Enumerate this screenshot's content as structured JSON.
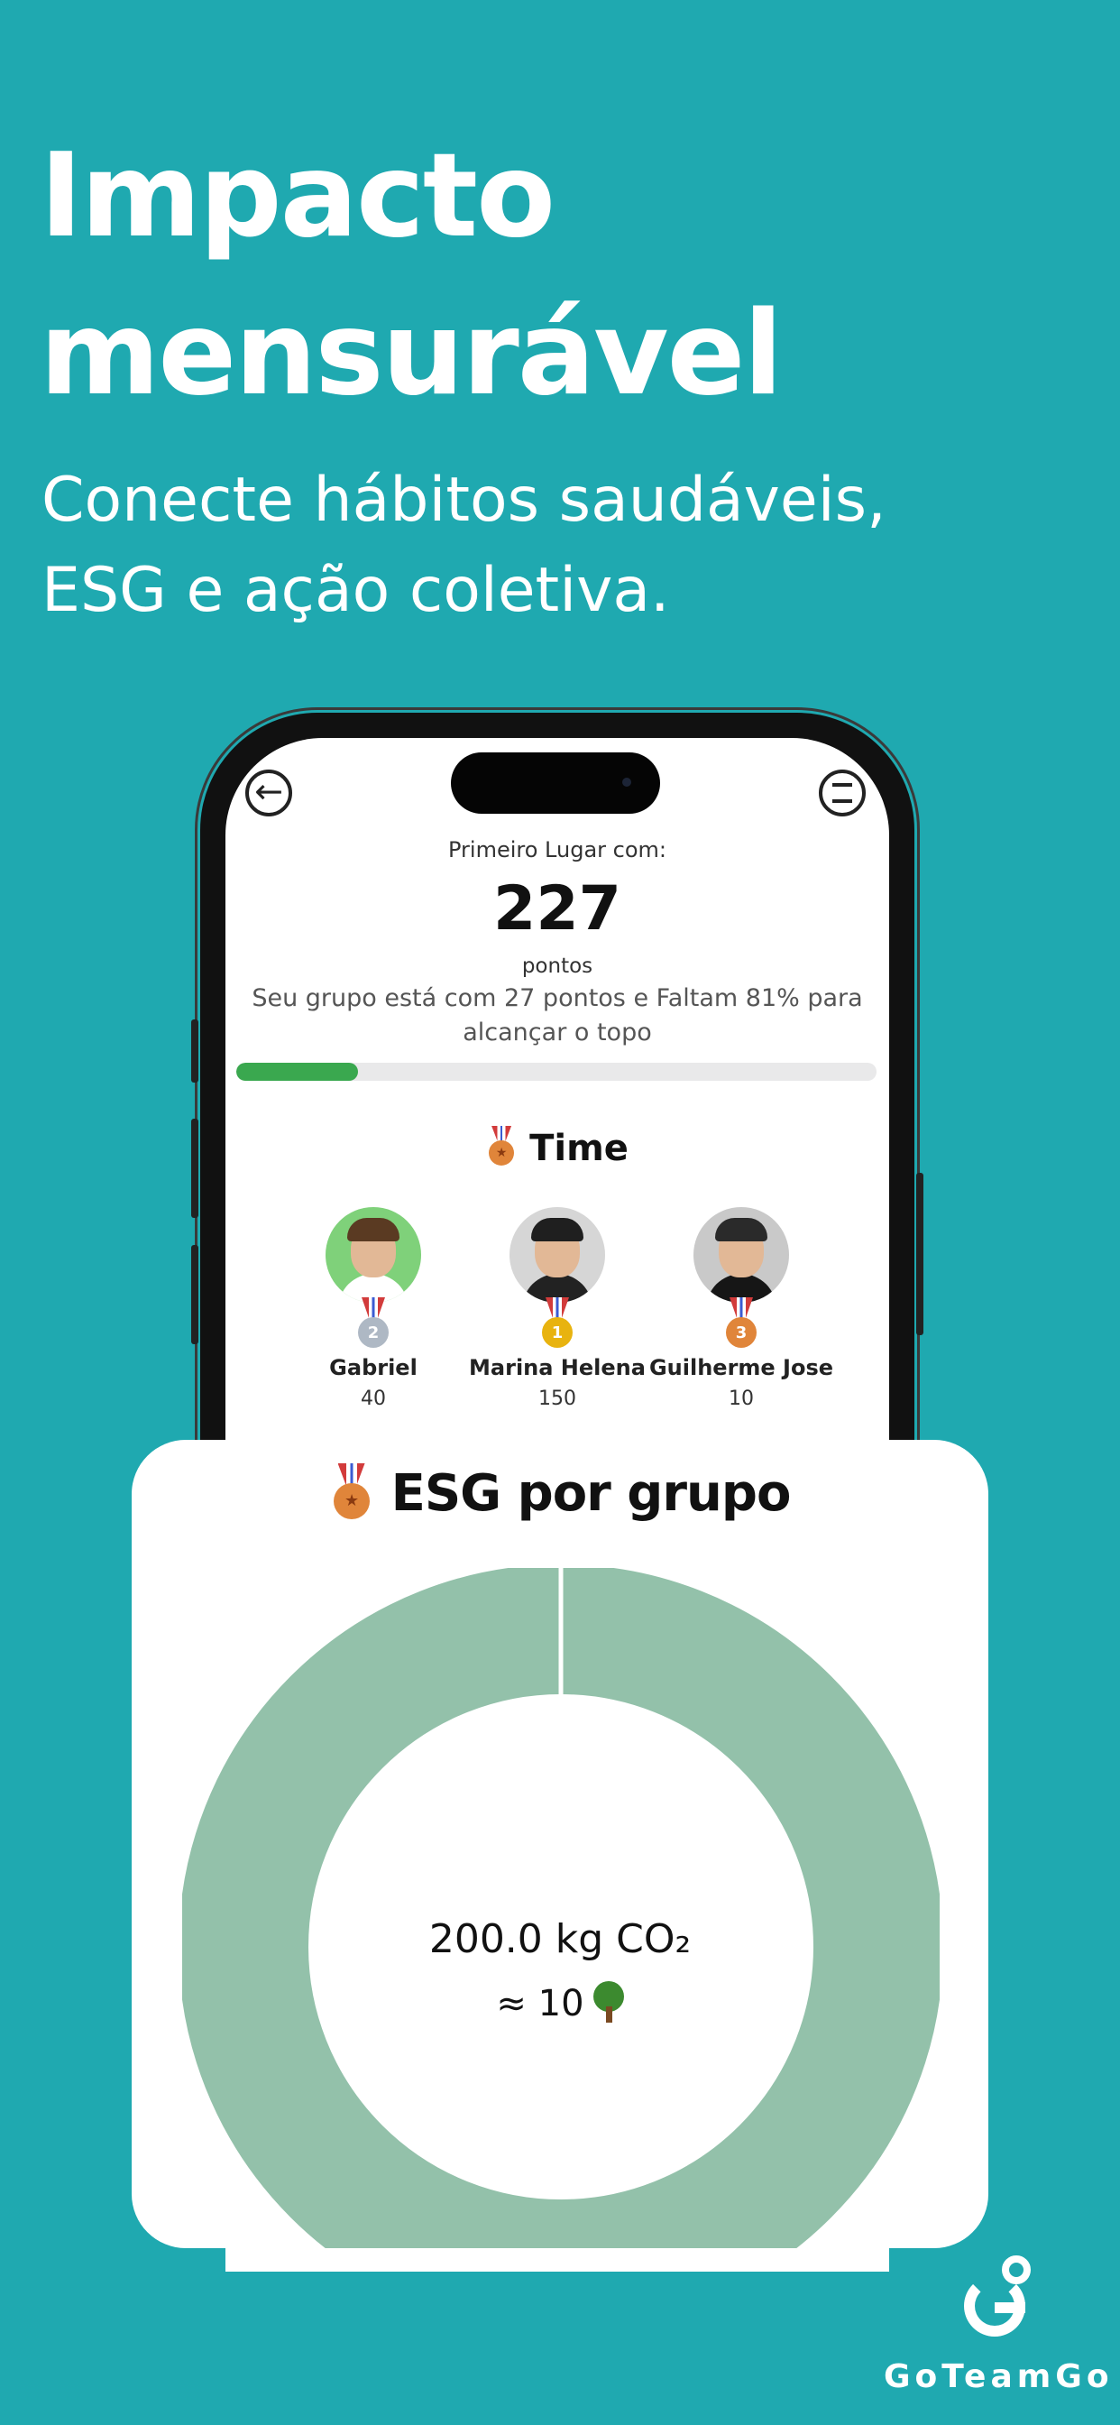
{
  "hero": {
    "headline_line1": "Impacto",
    "headline_line2": "mensurável",
    "subline_line1": "Conecte hábitos saudáveis,",
    "subline_line2": "ESG e ação coletiva."
  },
  "screen": {
    "first_place_label": "Primeiro Lugar com:",
    "score": "227",
    "score_unit": "pontos",
    "group_status": "Seu grupo está com 27 pontos e Faltam 81% para alcançar o topo",
    "progress_percent": 19,
    "team_title": "Time",
    "members": [
      {
        "name": "Gabriel",
        "points": "40",
        "rank": "2",
        "medal_color": "#aeb8c4",
        "avatar_bg": "#7fd17a",
        "hair": "#5a3a22",
        "shirt": "#ffffff"
      },
      {
        "name": "Marina Helena",
        "points": "150",
        "rank": "1",
        "medal_color": "#e8b30f",
        "avatar_bg": "#d6d6d6",
        "hair": "#1f1f1f",
        "shirt": "#222222"
      },
      {
        "name": "Guilherme Jose",
        "points": "10",
        "rank": "3",
        "medal_color": "#e0853a",
        "avatar_bg": "#c9c9c9",
        "hair": "#2a2a2a",
        "shirt": "#161616"
      }
    ]
  },
  "esg": {
    "title": "ESG por grupo",
    "co2_value": "200.0 kg CO₂",
    "trees_value": "≈ 10"
  },
  "chart_data": {
    "type": "pie",
    "title": "ESG por grupo",
    "categories": [
      "grupo"
    ],
    "values": [
      200.0
    ],
    "center_label": "200.0 kg CO₂",
    "color": "#93c1aa"
  },
  "logo": {
    "text": "GoTeamGo"
  },
  "colors": {
    "background": "#1fa9b0",
    "progress": "#3aa84f",
    "donut": "#93c1aa"
  }
}
